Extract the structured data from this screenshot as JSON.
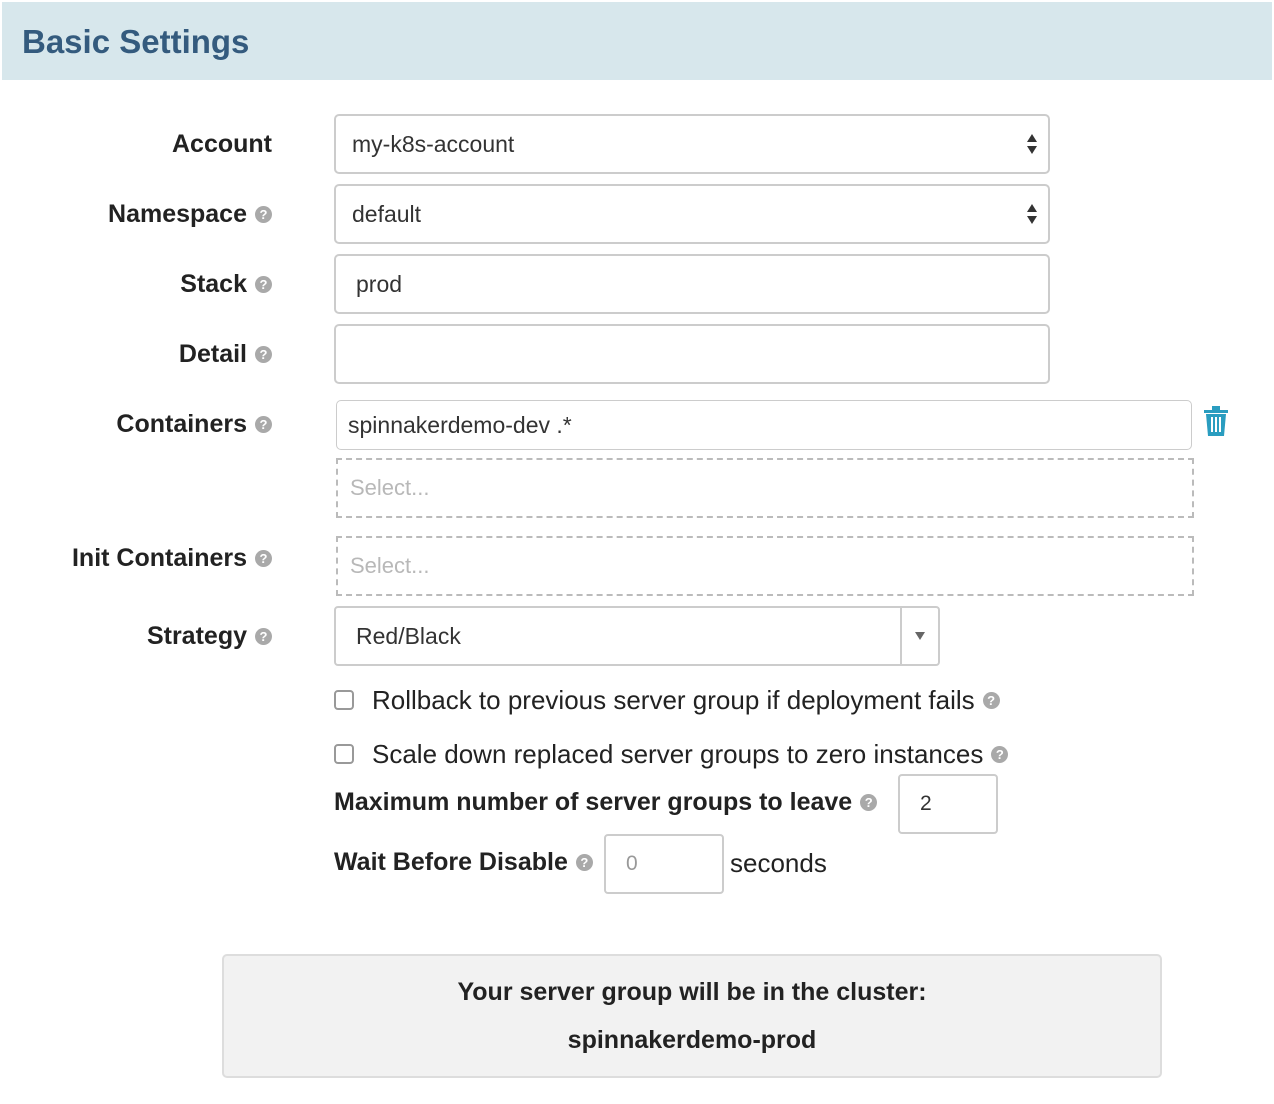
{
  "header": {
    "title": "Basic Settings"
  },
  "form": {
    "account": {
      "label": "Account",
      "value": "my-k8s-account"
    },
    "namespace": {
      "label": "Namespace",
      "value": "default"
    },
    "stack": {
      "label": "Stack",
      "value": "prod"
    },
    "detail": {
      "label": "Detail",
      "value": ""
    },
    "containers": {
      "label": "Containers",
      "value": "spinnakerdemo-dev .*",
      "placeholder": "Select..."
    },
    "init_containers": {
      "label": "Init Containers",
      "placeholder": "Select..."
    },
    "strategy": {
      "label": "Strategy",
      "value": "Red/Black"
    },
    "rollback_checkbox": {
      "label": "Rollback to previous server group if deployment fails",
      "checked": false
    },
    "scale_down_checkbox": {
      "label": "Scale down replaced server groups to zero instances",
      "checked": false
    },
    "max_server_groups": {
      "label": "Maximum number of server groups to leave",
      "value": "2"
    },
    "wait_before_disable": {
      "label": "Wait Before Disable",
      "placeholder": "0",
      "unit": "seconds"
    }
  },
  "summary": {
    "line1": "Your server group will be in the cluster:",
    "cluster_name": "spinnakerdemo-prod"
  },
  "icons": {
    "help": "?",
    "trash": "trash-icon"
  },
  "colors": {
    "header_bg": "#d7e7ec",
    "header_text": "#345b7e",
    "trash": "#2a9dc0"
  }
}
